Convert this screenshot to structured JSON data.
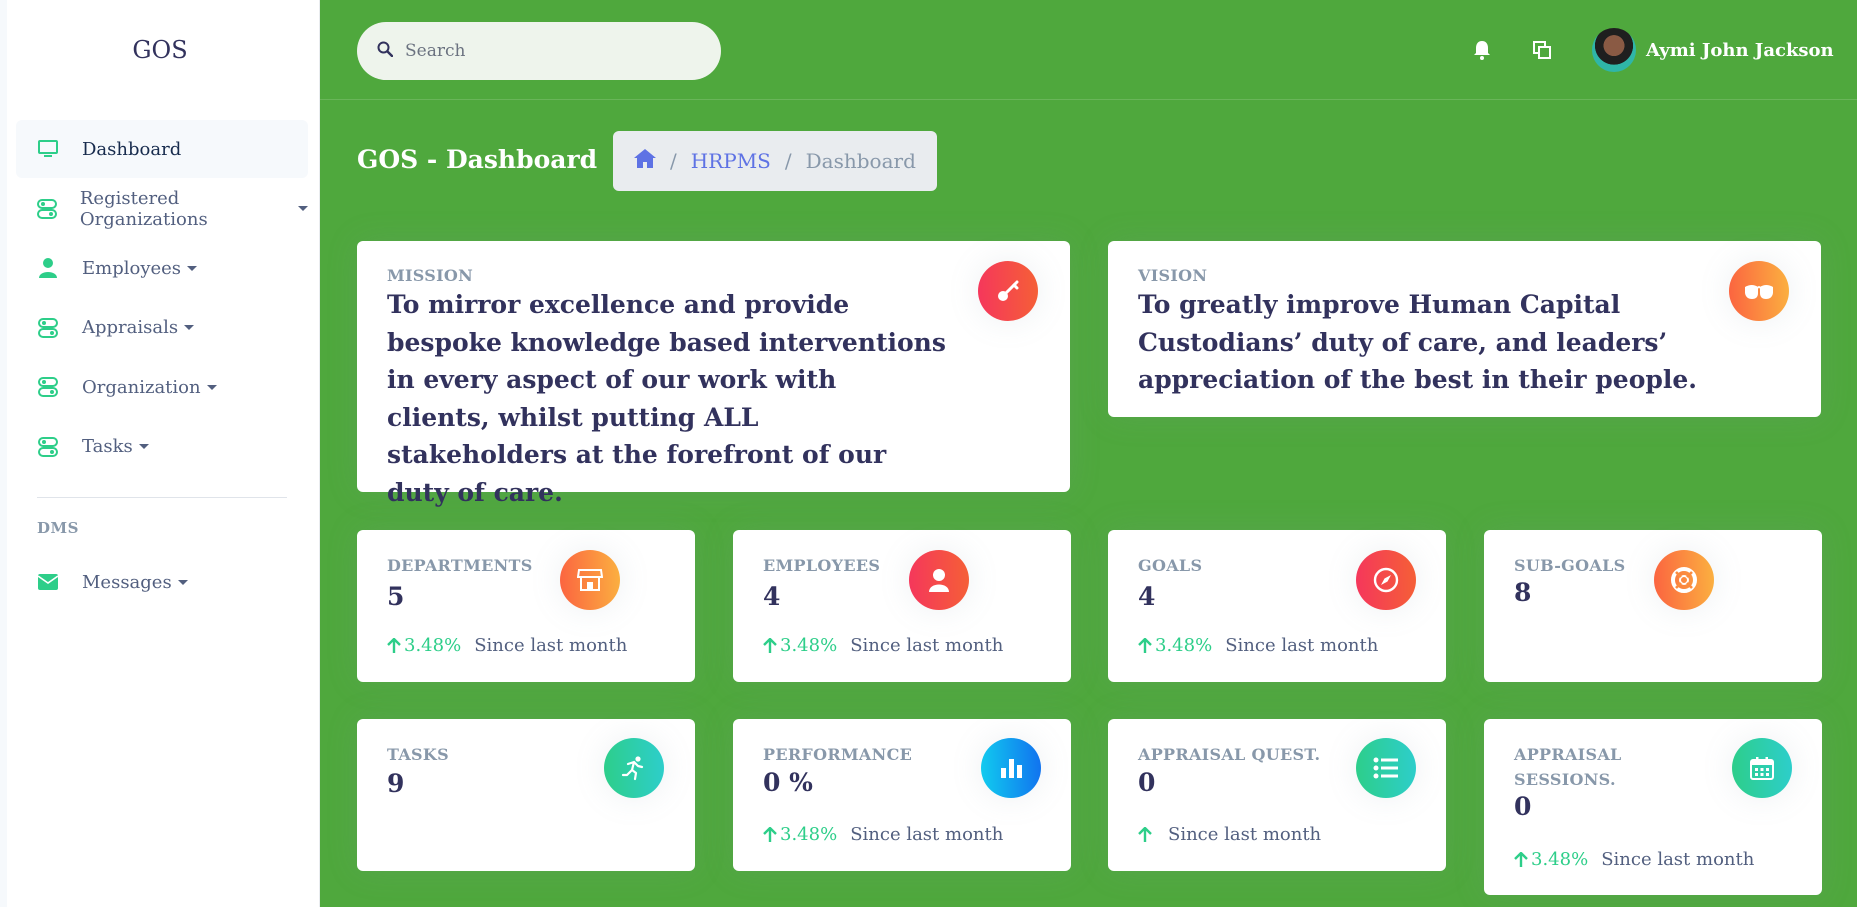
{
  "brand": "GOS",
  "sidebar": {
    "items": [
      {
        "label": "Dashboard"
      },
      {
        "label": "Registered Organizations"
      },
      {
        "label": "Employees"
      },
      {
        "label": "Appraisals"
      },
      {
        "label": "Organization"
      },
      {
        "label": "Tasks"
      }
    ],
    "section_heading": "DMS",
    "section_items": [
      {
        "label": "Messages"
      }
    ]
  },
  "topbar": {
    "search_placeholder": "Search",
    "user_name": "Aymi John Jackson"
  },
  "header": {
    "title": "GOS - Dashboard",
    "breadcrumb": {
      "sep": "/",
      "items": [
        "HRPMS",
        "Dashboard"
      ]
    }
  },
  "mission": {
    "label": "MISSION",
    "text": "To mirror excellence and provide bespoke knowledge based interventions in every aspect of our work with clients, whilst putting ALL stakeholders at the forefront of our duty of care."
  },
  "vision": {
    "label": "VISION",
    "text": "To greatly improve Human Capital Custodians’ duty of care, and leaders’ appreciation of the best in their people."
  },
  "stats": [
    {
      "label": "DEPARTMENTS",
      "value": "5",
      "pct": "3.48%",
      "since": "Since last month"
    },
    {
      "label": "EMPLOYEES",
      "value": "4",
      "pct": "3.48%",
      "since": "Since last month"
    },
    {
      "label": "GOALS",
      "value": "4",
      "pct": "3.48%",
      "since": "Since last month"
    },
    {
      "label": "SUB-GOALS",
      "value": "8"
    },
    {
      "label": "TASKS",
      "value": "9"
    },
    {
      "label": "PERFORMANCE",
      "value": "0 %",
      "pct": "3.48%",
      "since": "Since last month"
    },
    {
      "label": "APPRAISAL QUEST.",
      "value": "0",
      "since": "Since last month"
    },
    {
      "label_line1": "APPRAISAL",
      "label_line2": "SESSIONS.",
      "value": "0",
      "pct": "3.48%",
      "since": "Since last month"
    }
  ],
  "colors": {
    "main_bg": "#4fa83d",
    "accent_green": "#2dce89",
    "link_blue": "#5e72e4",
    "text_dark": "#32325d",
    "muted": "#8898aa"
  },
  "icons": {
    "dashboard": "monitor-icon",
    "registered_orgs": "toggles-icon",
    "employees": "person-icon",
    "messages": "envelope-icon",
    "notifications": "bell-icon",
    "windows": "copy-icon",
    "mission": "key-icon",
    "vision": "glasses-icon",
    "departments": "shop-icon",
    "employees_card": "user-icon",
    "goals": "compass-icon",
    "subgoals": "lifebuoy-icon",
    "tasks": "running-icon",
    "performance": "bar-chart-icon",
    "quest": "list-icon",
    "sessions": "calendar-icon"
  }
}
